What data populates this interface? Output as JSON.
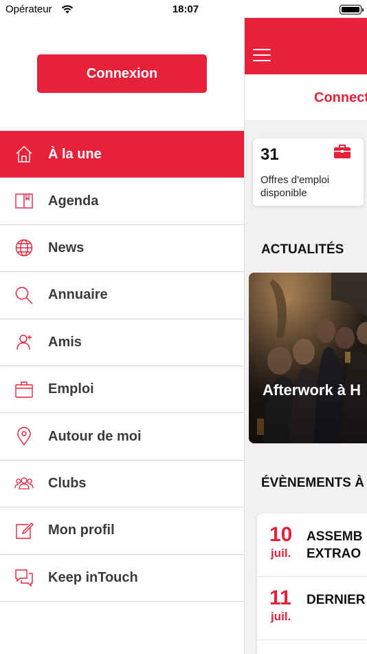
{
  "status_bar": {
    "carrier": "Opérateur",
    "time": "18:07"
  },
  "drawer": {
    "login_label": "Connexion",
    "accent_color": "#e8213a",
    "items": [
      {
        "label": "À la une",
        "icon": "home-icon",
        "active": true
      },
      {
        "label": "Agenda",
        "icon": "book-icon",
        "active": false
      },
      {
        "label": "News",
        "icon": "globe-icon",
        "active": false
      },
      {
        "label": "Annuaire",
        "icon": "search-icon",
        "active": false
      },
      {
        "label": "Amis",
        "icon": "add-friend-icon",
        "active": false
      },
      {
        "label": "Emploi",
        "icon": "briefcase-icon",
        "active": false
      },
      {
        "label": "Autour de moi",
        "icon": "location-pin-icon",
        "active": false
      },
      {
        "label": "Clubs",
        "icon": "group-icon",
        "active": false
      },
      {
        "label": "Mon profil",
        "icon": "edit-icon",
        "active": false
      },
      {
        "label": "Keep inTouch",
        "icon": "chat-icon",
        "active": false
      }
    ]
  },
  "main": {
    "connect_link": "Connect",
    "jobs": {
      "count": "31",
      "label": "Offres d'emploi disponible"
    },
    "news_section_title": "ACTUALITÉS",
    "news_caption": "Afterwork à H",
    "events_section_title": "ÉVÈNEMENTS À",
    "events": [
      {
        "day": "10",
        "month": "juil.",
        "title_line1": "ASSEMB",
        "title_line2": "EXTRAO"
      },
      {
        "day": "11",
        "month": "juil.",
        "title_line1": "DERNIER",
        "title_line2": ""
      }
    ]
  }
}
